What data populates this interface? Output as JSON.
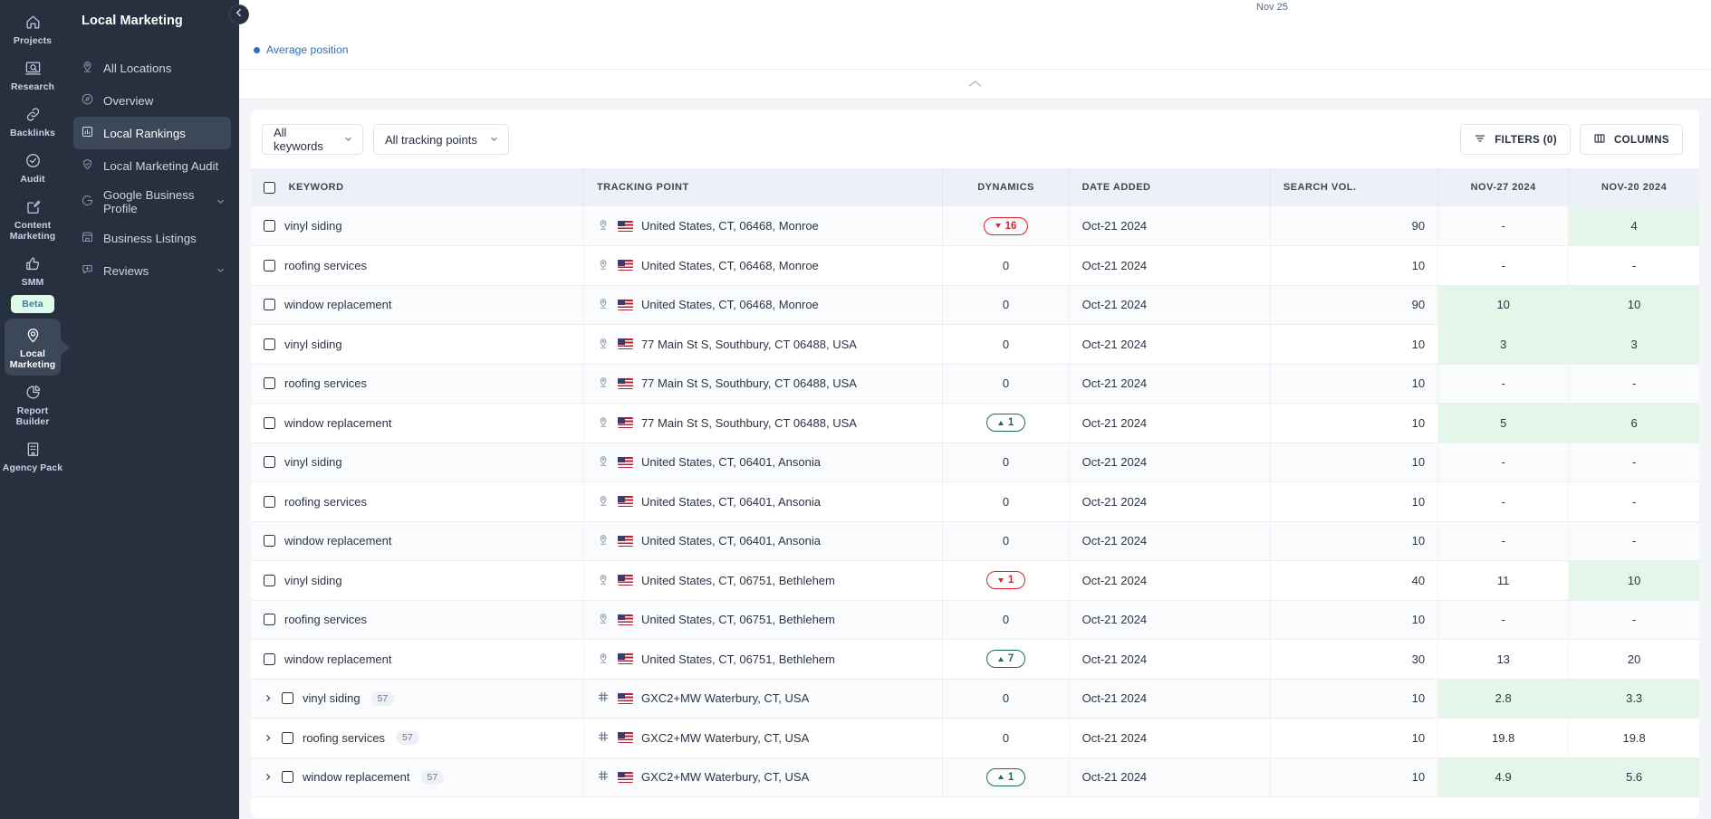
{
  "rail": {
    "items": [
      {
        "label": "Projects",
        "icon": "home-icon",
        "active": false
      },
      {
        "label": "Research",
        "icon": "research-icon",
        "active": false
      },
      {
        "label": "Backlinks",
        "icon": "link-icon",
        "active": false
      },
      {
        "label": "Audit",
        "icon": "check-circle-icon",
        "active": false
      },
      {
        "label": "Content Marketing",
        "icon": "edit-square-icon",
        "active": false
      },
      {
        "label": "SMM",
        "icon": "thumbs-up-icon",
        "active": false,
        "badge": "Beta"
      },
      {
        "label": "Local Marketing",
        "icon": "map-pin-icon",
        "active": true
      },
      {
        "label": "Report Builder",
        "icon": "pie-chart-icon",
        "active": false
      },
      {
        "label": "Agency Pack",
        "icon": "building-icon",
        "active": false
      }
    ]
  },
  "subnav": {
    "title": "Local Marketing",
    "items": [
      {
        "label": "All Locations",
        "icon": "map-pin-icon",
        "active": false,
        "expandable": false
      },
      {
        "label": "Overview",
        "icon": "compass-icon",
        "active": false,
        "expandable": false
      },
      {
        "label": "Local Rankings",
        "icon": "bar-chart-icon",
        "active": true,
        "expandable": false
      },
      {
        "label": "Local Marketing Audit",
        "icon": "shield-pin-icon",
        "active": false,
        "expandable": false
      },
      {
        "label": "Google Business Profile",
        "icon": "google-icon",
        "active": false,
        "expandable": true
      },
      {
        "label": "Business Listings",
        "icon": "storefront-icon",
        "active": false,
        "expandable": false
      },
      {
        "label": "Reviews",
        "icon": "review-icon",
        "active": false,
        "expandable": true
      }
    ]
  },
  "chart": {
    "x_tick_label": "Nov 25",
    "legend_label": "Average position",
    "legend_color": "#2f6fb5",
    "collapse_icon": "chevron-up-icon"
  },
  "toolbar": {
    "keyword_filter": "All keywords",
    "tracking_point_filter": "All tracking points",
    "filters_label": "FILTERS (0)",
    "columns_label": "COLUMNS"
  },
  "table": {
    "columns": [
      "KEYWORD",
      "TRACKING POINT",
      "DYNAMICS",
      "DATE ADDED",
      "SEARCH VOL.",
      "NOV-27 2024",
      "NOV-20 2024"
    ],
    "rows": [
      {
        "keyword": "vinyl siding",
        "expandable": false,
        "count": null,
        "tp_icon": "map-pin-icon",
        "tracking_point": "United States, CT, 06468, Monroe",
        "dynamics": "16",
        "dyn_dir": "down",
        "date_added": "Oct-21 2024",
        "search_vol": "90",
        "nov27": "-",
        "nov27_hl": false,
        "nov20": "4",
        "nov20_hl": true
      },
      {
        "keyword": "roofing services",
        "expandable": false,
        "count": null,
        "tp_icon": "map-pin-icon",
        "tracking_point": "United States, CT, 06468, Monroe",
        "dynamics": "0",
        "dyn_dir": "none",
        "date_added": "Oct-21 2024",
        "search_vol": "10",
        "nov27": "-",
        "nov27_hl": false,
        "nov20": "-",
        "nov20_hl": false
      },
      {
        "keyword": "window replacement",
        "expandable": false,
        "count": null,
        "tp_icon": "map-pin-icon",
        "tracking_point": "United States, CT, 06468, Monroe",
        "dynamics": "0",
        "dyn_dir": "none",
        "date_added": "Oct-21 2024",
        "search_vol": "90",
        "nov27": "10",
        "nov27_hl": true,
        "nov20": "10",
        "nov20_hl": true
      },
      {
        "keyword": "vinyl siding",
        "expandable": false,
        "count": null,
        "tp_icon": "map-pin-icon",
        "tracking_point": "77 Main St S, Southbury, CT 06488, USA",
        "dynamics": "0",
        "dyn_dir": "none",
        "date_added": "Oct-21 2024",
        "search_vol": "10",
        "nov27": "3",
        "nov27_hl": true,
        "nov20": "3",
        "nov20_hl": true
      },
      {
        "keyword": "roofing services",
        "expandable": false,
        "count": null,
        "tp_icon": "map-pin-icon",
        "tracking_point": "77 Main St S, Southbury, CT 06488, USA",
        "dynamics": "0",
        "dyn_dir": "none",
        "date_added": "Oct-21 2024",
        "search_vol": "10",
        "nov27": "-",
        "nov27_hl": false,
        "nov20": "-",
        "nov20_hl": false
      },
      {
        "keyword": "window replacement",
        "expandable": false,
        "count": null,
        "tp_icon": "map-pin-icon",
        "tracking_point": "77 Main St S, Southbury, CT 06488, USA",
        "dynamics": "1",
        "dyn_dir": "up",
        "date_added": "Oct-21 2024",
        "search_vol": "10",
        "nov27": "5",
        "nov27_hl": true,
        "nov20": "6",
        "nov20_hl": true
      },
      {
        "keyword": "vinyl siding",
        "expandable": false,
        "count": null,
        "tp_icon": "map-pin-icon",
        "tracking_point": "United States, CT, 06401, Ansonia",
        "dynamics": "0",
        "dyn_dir": "none",
        "date_added": "Oct-21 2024",
        "search_vol": "10",
        "nov27": "-",
        "nov27_hl": false,
        "nov20": "-",
        "nov20_hl": false
      },
      {
        "keyword": "roofing services",
        "expandable": false,
        "count": null,
        "tp_icon": "map-pin-icon",
        "tracking_point": "United States, CT, 06401, Ansonia",
        "dynamics": "0",
        "dyn_dir": "none",
        "date_added": "Oct-21 2024",
        "search_vol": "10",
        "nov27": "-",
        "nov27_hl": false,
        "nov20": "-",
        "nov20_hl": false
      },
      {
        "keyword": "window replacement",
        "expandable": false,
        "count": null,
        "tp_icon": "map-pin-icon",
        "tracking_point": "United States, CT, 06401, Ansonia",
        "dynamics": "0",
        "dyn_dir": "none",
        "date_added": "Oct-21 2024",
        "search_vol": "10",
        "nov27": "-",
        "nov27_hl": false,
        "nov20": "-",
        "nov20_hl": false
      },
      {
        "keyword": "vinyl siding",
        "expandable": false,
        "count": null,
        "tp_icon": "map-pin-icon",
        "tracking_point": "United States, CT, 06751, Bethlehem",
        "dynamics": "1",
        "dyn_dir": "down",
        "date_added": "Oct-21 2024",
        "search_vol": "40",
        "nov27": "11",
        "nov27_hl": false,
        "nov20": "10",
        "nov20_hl": true
      },
      {
        "keyword": "roofing services",
        "expandable": false,
        "count": null,
        "tp_icon": "map-pin-icon",
        "tracking_point": "United States, CT, 06751, Bethlehem",
        "dynamics": "0",
        "dyn_dir": "none",
        "date_added": "Oct-21 2024",
        "search_vol": "10",
        "nov27": "-",
        "nov27_hl": false,
        "nov20": "-",
        "nov20_hl": false
      },
      {
        "keyword": "window replacement",
        "expandable": false,
        "count": null,
        "tp_icon": "map-pin-icon",
        "tracking_point": "United States, CT, 06751, Bethlehem",
        "dynamics": "7",
        "dyn_dir": "up",
        "date_added": "Oct-21 2024",
        "search_vol": "30",
        "nov27": "13",
        "nov27_hl": false,
        "nov20": "20",
        "nov20_hl": false
      },
      {
        "keyword": "vinyl siding",
        "expandable": true,
        "count": "57",
        "tp_icon": "grid-icon",
        "tracking_point": "GXC2+MW Waterbury, CT, USA",
        "dynamics": "0",
        "dyn_dir": "none",
        "date_added": "Oct-21 2024",
        "search_vol": "10",
        "nov27": "2.8",
        "nov27_hl": true,
        "nov20": "3.3",
        "nov20_hl": true
      },
      {
        "keyword": "roofing services",
        "expandable": true,
        "count": "57",
        "tp_icon": "grid-icon",
        "tracking_point": "GXC2+MW Waterbury, CT, USA",
        "dynamics": "0",
        "dyn_dir": "none",
        "date_added": "Oct-21 2024",
        "search_vol": "10",
        "nov27": "19.8",
        "nov27_hl": false,
        "nov20": "19.8",
        "nov20_hl": false
      },
      {
        "keyword": "window replacement",
        "expandable": true,
        "count": "57",
        "tp_icon": "grid-icon",
        "tracking_point": "GXC2+MW Waterbury, CT, USA",
        "dynamics": "1",
        "dyn_dir": "up",
        "date_added": "Oct-21 2024",
        "search_vol": "10",
        "nov27": "4.9",
        "nov27_hl": true,
        "nov20": "5.6",
        "nov20_hl": true
      }
    ]
  }
}
